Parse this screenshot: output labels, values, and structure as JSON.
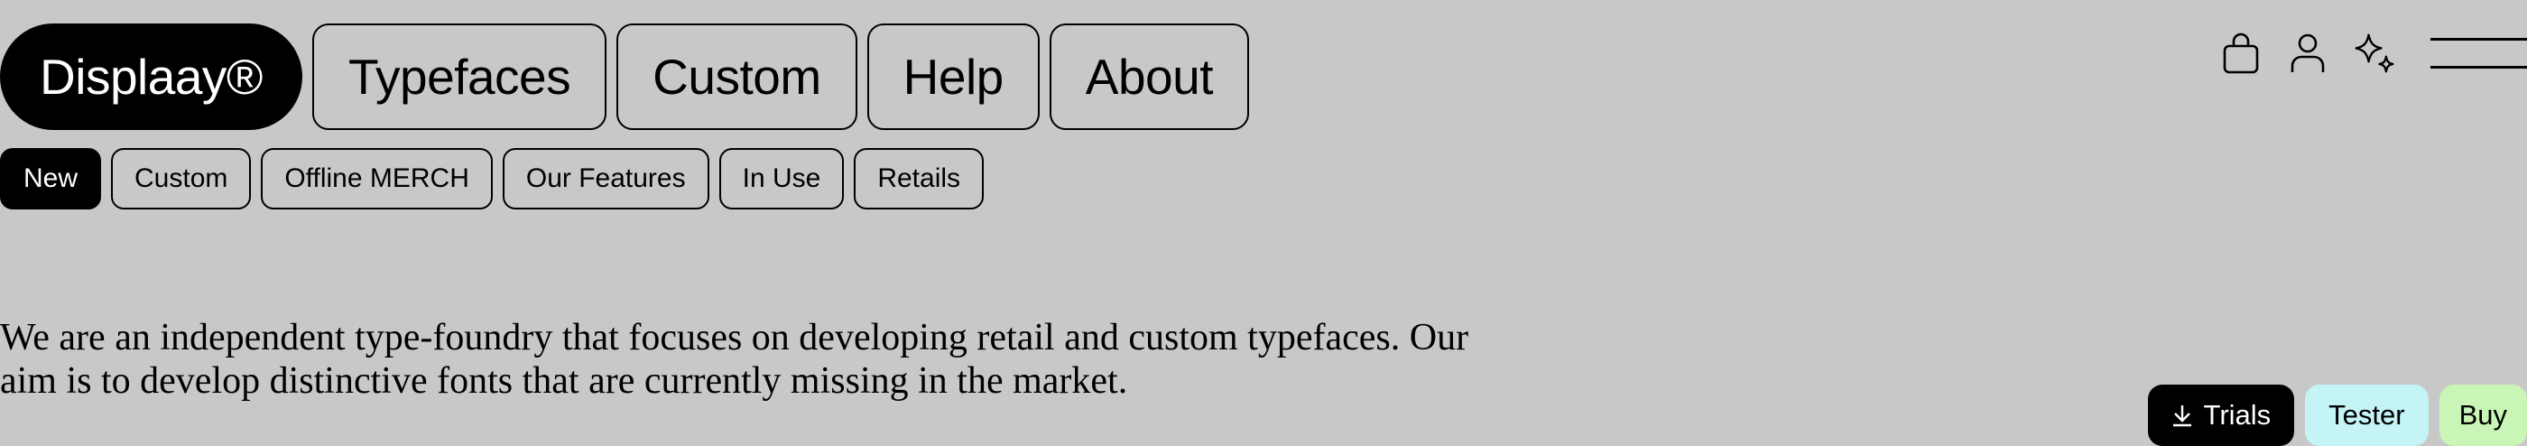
{
  "brand": {
    "label": "Displaay®"
  },
  "main_nav": {
    "items": [
      {
        "label": "Typefaces"
      },
      {
        "label": "Custom"
      },
      {
        "label": "Help"
      },
      {
        "label": "About"
      }
    ]
  },
  "header_icons": [
    "bag-icon",
    "user-icon",
    "sparkle-icon",
    "menu-icon"
  ],
  "sub_nav": {
    "items": [
      {
        "label": "New",
        "active": true
      },
      {
        "label": "Custom"
      },
      {
        "label": "Offline MERCH"
      },
      {
        "label": "Our Features"
      },
      {
        "label": "In Use"
      },
      {
        "label": "Retails"
      }
    ]
  },
  "intro": {
    "text": "We are an independent type-foundry that focuses on developing retail and custom typefaces. Our aim is to develop distinctive fonts that are currently missing in the market."
  },
  "actions": {
    "trials_label": "Trials",
    "tester_label": "Tester",
    "buy_label": "Buy"
  },
  "colors": {
    "background": "#c8c8c8",
    "tester_bg": "#c5f4f7",
    "buy_bg": "#c9f5b7",
    "primary": "#000000"
  }
}
